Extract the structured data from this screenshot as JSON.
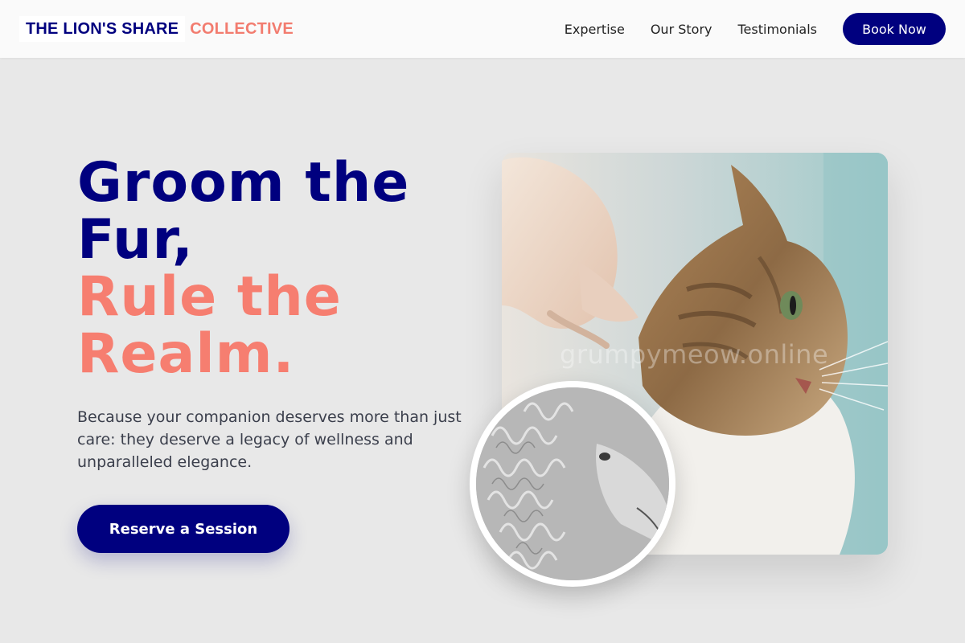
{
  "header": {
    "logo_main": "THE LION'S SHARE",
    "logo_accent": "COLLECTIVE",
    "nav": [
      "Expertise",
      "Our Story",
      "Testimonials"
    ],
    "cta_label": "Book Now"
  },
  "hero": {
    "title_line1": "Groom the",
    "title_line2": "Fur,",
    "title_line3": "Rule the",
    "title_line4": "Realm.",
    "description": "Because your companion deserves more than just care: they deserve a legacy of wellness and unparalleled elegance.",
    "button_label": "Reserve a Session",
    "photo_watermark": "grumpymeow.online"
  },
  "colors": {
    "navy": "#00007f",
    "coral": "#f67e70",
    "background": "#e8e8e8"
  }
}
